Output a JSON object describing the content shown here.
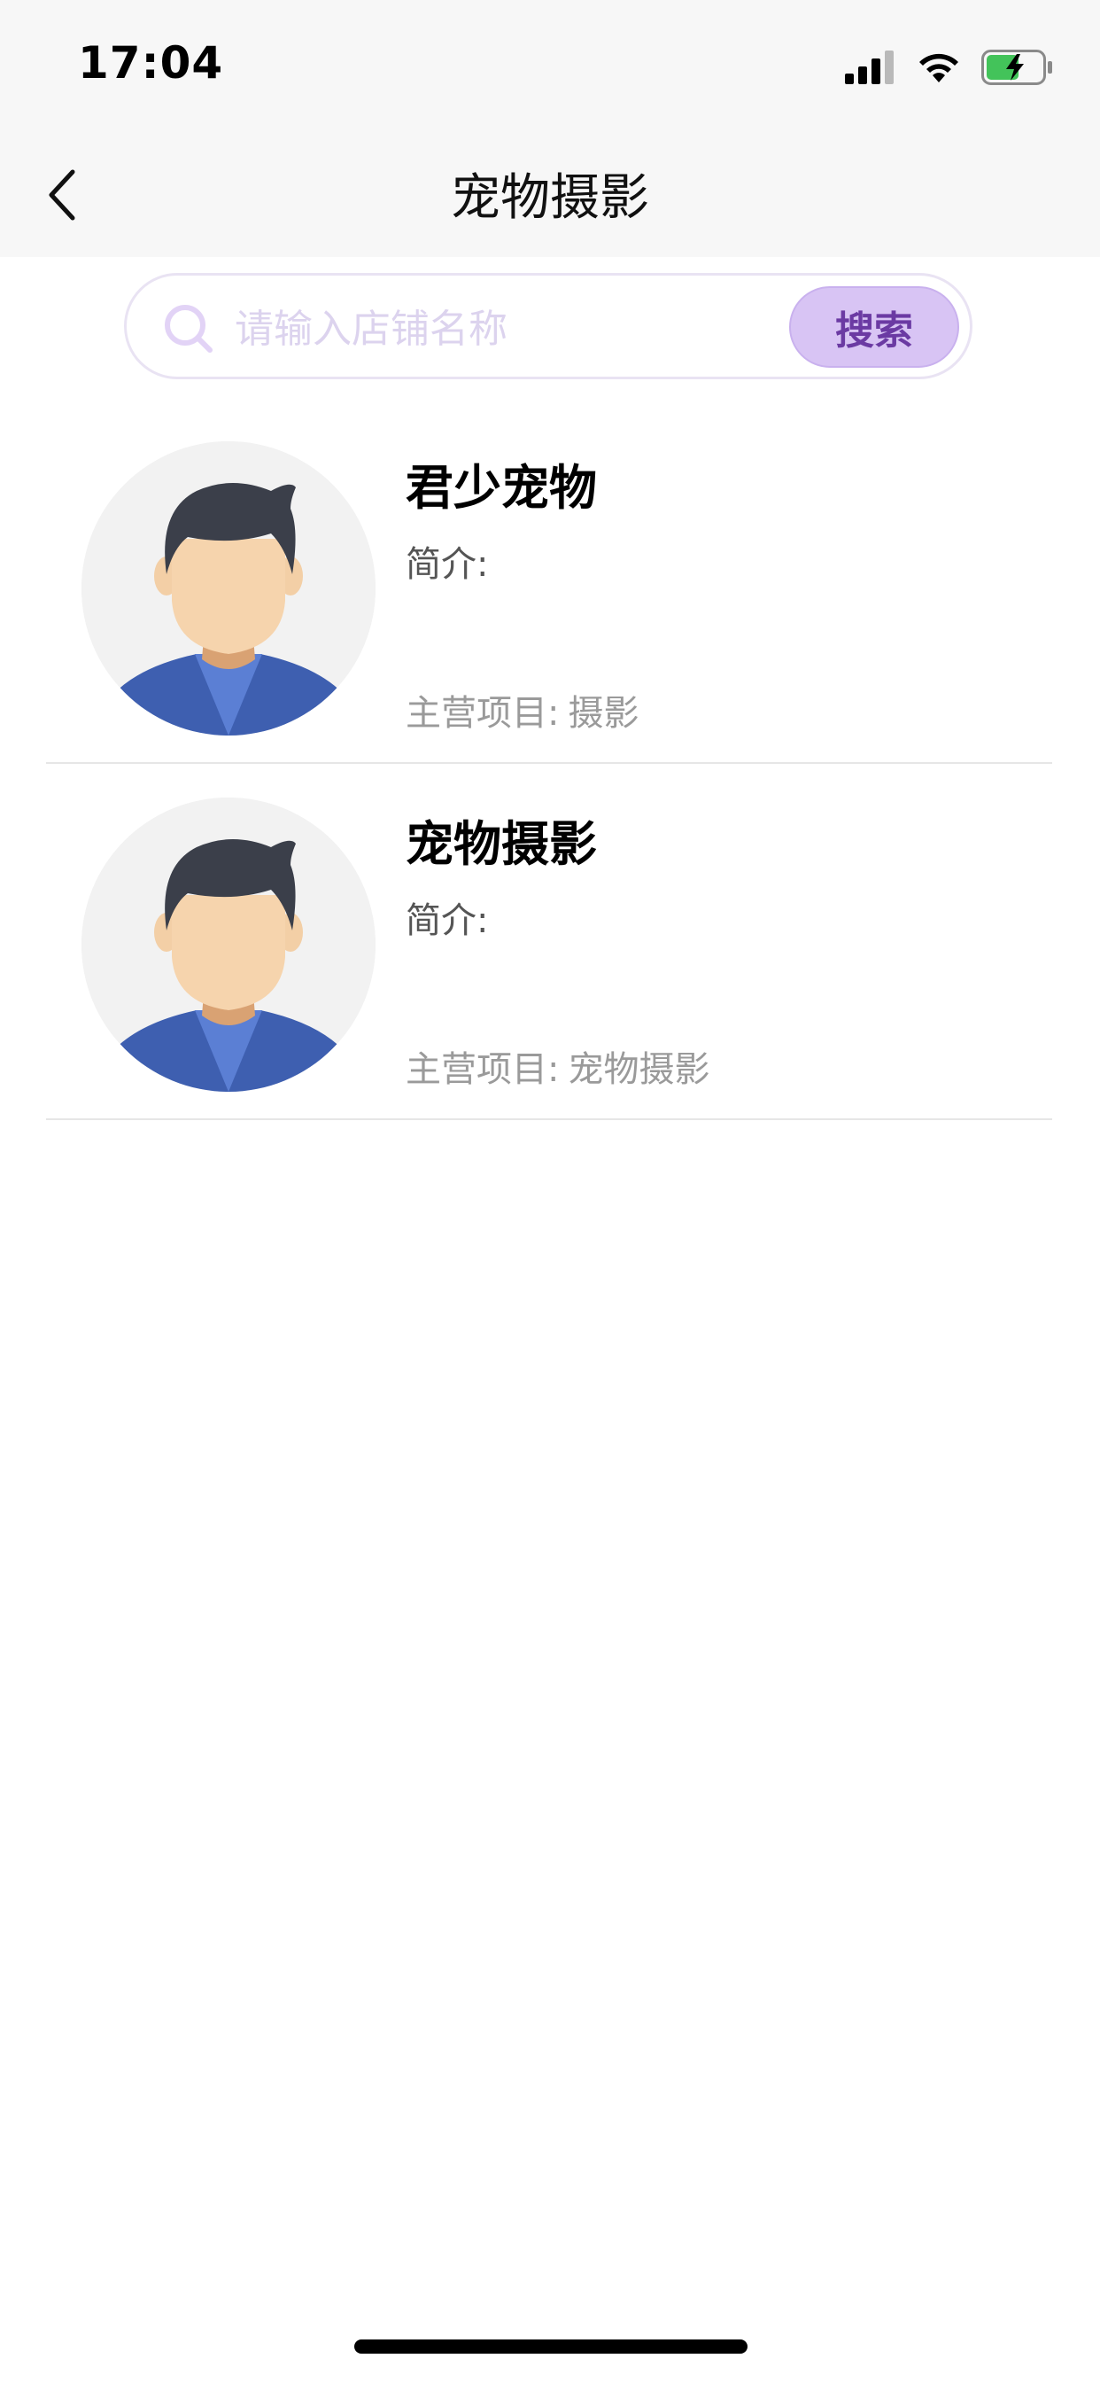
{
  "status_bar": {
    "time": "17:04",
    "icons": [
      "signal-icon",
      "wifi-icon",
      "battery-charging-icon"
    ]
  },
  "header": {
    "title": "宠物摄影",
    "back_icon": "chevron-left-icon"
  },
  "search": {
    "placeholder": "请输入店铺名称",
    "value": "",
    "button_label": "搜索",
    "accent_color": "#d8c4f4",
    "button_text_color": "#6b3aa3"
  },
  "shops": [
    {
      "name": "君少宠物",
      "intro_label": "简介:",
      "intro_value": "",
      "business_label": "主营项目:",
      "business_value": "摄影",
      "avatar_icon": "male-avatar-icon"
    },
    {
      "name": "宠物摄影",
      "intro_label": "简介:",
      "intro_value": "",
      "business_label": "主营项目:",
      "business_value": "宠物摄影",
      "avatar_icon": "male-avatar-icon"
    }
  ]
}
